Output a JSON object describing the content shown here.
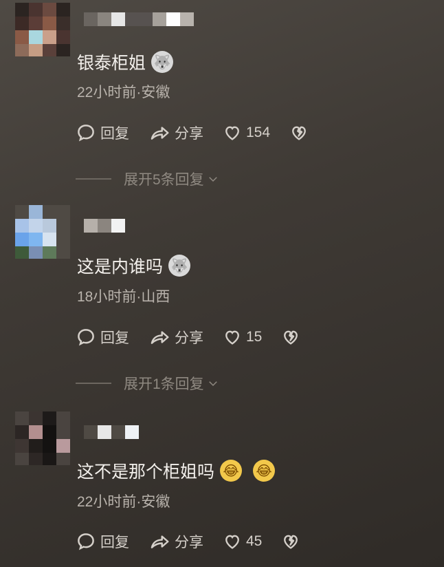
{
  "comments": [
    {
      "text": "银泰柜姐",
      "time_location": "22小时前·安徽",
      "reply": "回复",
      "share": "分享",
      "likes": "154",
      "expand": "展开5条回复",
      "emoji": "🐺"
    },
    {
      "text": "这是内谁吗",
      "time_location": "18小时前·山西",
      "reply": "回复",
      "share": "分享",
      "likes": "15",
      "expand": "展开1条回复",
      "emoji": "🐺"
    },
    {
      "text": "这不是那个柜姐吗",
      "time_location": "22小时前·安徽",
      "reply": "回复",
      "share": "分享",
      "likes": "45",
      "emoji1": "😂",
      "emoji2": "😂"
    }
  ]
}
